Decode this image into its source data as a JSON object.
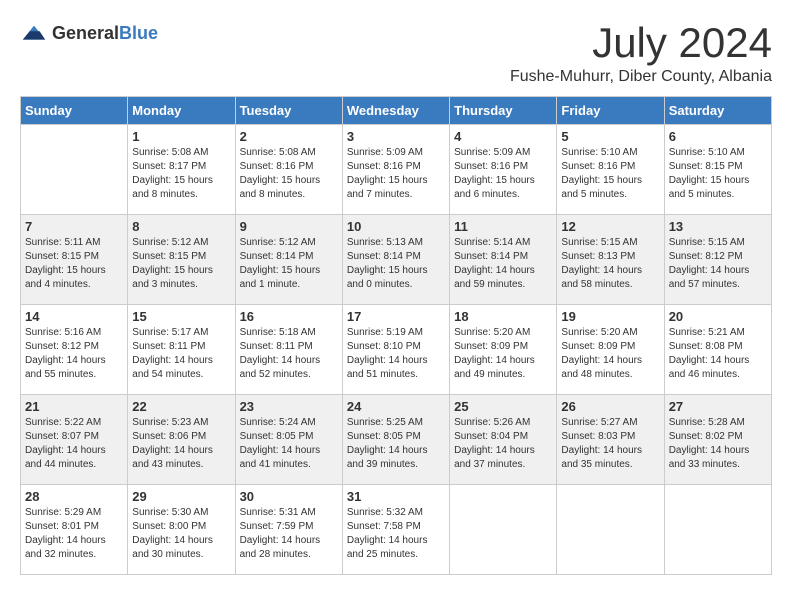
{
  "logo": {
    "general": "General",
    "blue": "Blue"
  },
  "title": "July 2024",
  "location": "Fushe-Muhurr, Diber County, Albania",
  "days_of_week": [
    "Sunday",
    "Monday",
    "Tuesday",
    "Wednesday",
    "Thursday",
    "Friday",
    "Saturday"
  ],
  "weeks": [
    [
      {
        "day": "",
        "content": ""
      },
      {
        "day": "1",
        "content": "Sunrise: 5:08 AM\nSunset: 8:17 PM\nDaylight: 15 hours\nand 8 minutes."
      },
      {
        "day": "2",
        "content": "Sunrise: 5:08 AM\nSunset: 8:16 PM\nDaylight: 15 hours\nand 8 minutes."
      },
      {
        "day": "3",
        "content": "Sunrise: 5:09 AM\nSunset: 8:16 PM\nDaylight: 15 hours\nand 7 minutes."
      },
      {
        "day": "4",
        "content": "Sunrise: 5:09 AM\nSunset: 8:16 PM\nDaylight: 15 hours\nand 6 minutes."
      },
      {
        "day": "5",
        "content": "Sunrise: 5:10 AM\nSunset: 8:16 PM\nDaylight: 15 hours\nand 5 minutes."
      },
      {
        "day": "6",
        "content": "Sunrise: 5:10 AM\nSunset: 8:15 PM\nDaylight: 15 hours\nand 5 minutes."
      }
    ],
    [
      {
        "day": "7",
        "content": "Sunrise: 5:11 AM\nSunset: 8:15 PM\nDaylight: 15 hours\nand 4 minutes."
      },
      {
        "day": "8",
        "content": "Sunrise: 5:12 AM\nSunset: 8:15 PM\nDaylight: 15 hours\nand 3 minutes."
      },
      {
        "day": "9",
        "content": "Sunrise: 5:12 AM\nSunset: 8:14 PM\nDaylight: 15 hours\nand 1 minute."
      },
      {
        "day": "10",
        "content": "Sunrise: 5:13 AM\nSunset: 8:14 PM\nDaylight: 15 hours\nand 0 minutes."
      },
      {
        "day": "11",
        "content": "Sunrise: 5:14 AM\nSunset: 8:14 PM\nDaylight: 14 hours\nand 59 minutes."
      },
      {
        "day": "12",
        "content": "Sunrise: 5:15 AM\nSunset: 8:13 PM\nDaylight: 14 hours\nand 58 minutes."
      },
      {
        "day": "13",
        "content": "Sunrise: 5:15 AM\nSunset: 8:12 PM\nDaylight: 14 hours\nand 57 minutes."
      }
    ],
    [
      {
        "day": "14",
        "content": "Sunrise: 5:16 AM\nSunset: 8:12 PM\nDaylight: 14 hours\nand 55 minutes."
      },
      {
        "day": "15",
        "content": "Sunrise: 5:17 AM\nSunset: 8:11 PM\nDaylight: 14 hours\nand 54 minutes."
      },
      {
        "day": "16",
        "content": "Sunrise: 5:18 AM\nSunset: 8:11 PM\nDaylight: 14 hours\nand 52 minutes."
      },
      {
        "day": "17",
        "content": "Sunrise: 5:19 AM\nSunset: 8:10 PM\nDaylight: 14 hours\nand 51 minutes."
      },
      {
        "day": "18",
        "content": "Sunrise: 5:20 AM\nSunset: 8:09 PM\nDaylight: 14 hours\nand 49 minutes."
      },
      {
        "day": "19",
        "content": "Sunrise: 5:20 AM\nSunset: 8:09 PM\nDaylight: 14 hours\nand 48 minutes."
      },
      {
        "day": "20",
        "content": "Sunrise: 5:21 AM\nSunset: 8:08 PM\nDaylight: 14 hours\nand 46 minutes."
      }
    ],
    [
      {
        "day": "21",
        "content": "Sunrise: 5:22 AM\nSunset: 8:07 PM\nDaylight: 14 hours\nand 44 minutes."
      },
      {
        "day": "22",
        "content": "Sunrise: 5:23 AM\nSunset: 8:06 PM\nDaylight: 14 hours\nand 43 minutes."
      },
      {
        "day": "23",
        "content": "Sunrise: 5:24 AM\nSunset: 8:05 PM\nDaylight: 14 hours\nand 41 minutes."
      },
      {
        "day": "24",
        "content": "Sunrise: 5:25 AM\nSunset: 8:05 PM\nDaylight: 14 hours\nand 39 minutes."
      },
      {
        "day": "25",
        "content": "Sunrise: 5:26 AM\nSunset: 8:04 PM\nDaylight: 14 hours\nand 37 minutes."
      },
      {
        "day": "26",
        "content": "Sunrise: 5:27 AM\nSunset: 8:03 PM\nDaylight: 14 hours\nand 35 minutes."
      },
      {
        "day": "27",
        "content": "Sunrise: 5:28 AM\nSunset: 8:02 PM\nDaylight: 14 hours\nand 33 minutes."
      }
    ],
    [
      {
        "day": "28",
        "content": "Sunrise: 5:29 AM\nSunset: 8:01 PM\nDaylight: 14 hours\nand 32 minutes."
      },
      {
        "day": "29",
        "content": "Sunrise: 5:30 AM\nSunset: 8:00 PM\nDaylight: 14 hours\nand 30 minutes."
      },
      {
        "day": "30",
        "content": "Sunrise: 5:31 AM\nSunset: 7:59 PM\nDaylight: 14 hours\nand 28 minutes."
      },
      {
        "day": "31",
        "content": "Sunrise: 5:32 AM\nSunset: 7:58 PM\nDaylight: 14 hours\nand 25 minutes."
      },
      {
        "day": "",
        "content": ""
      },
      {
        "day": "",
        "content": ""
      },
      {
        "day": "",
        "content": ""
      }
    ]
  ]
}
